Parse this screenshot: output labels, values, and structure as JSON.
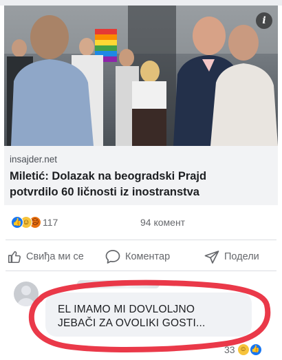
{
  "post": {
    "photo_badge": "i",
    "link_card": {
      "domain": "insajder.net",
      "headline": "Miletić: Dolazak na beogradski Prajd potvrdilo 60 ličnosti iz inostranstva"
    },
    "reactions": {
      "icons": [
        "like-icon",
        "haha-icon",
        "angry-icon"
      ],
      "count": "117",
      "comments": "94 комент"
    },
    "actions": {
      "like": "Свиђа ми се",
      "comment": "Коментар",
      "share": "Подели"
    }
  },
  "comment": {
    "text": "EL IMAMO MI DOVLOLJNO\nJEBAČI ZA OVOLIKI GOSTI...",
    "reaction_count": "33",
    "reaction_icons": [
      "haha-icon",
      "like-icon"
    ],
    "highlight_color": "#e8283a"
  },
  "colors": {
    "fb_blue": "#1877f2",
    "text_secondary": "#65676b",
    "card_bg": "#f2f3f5"
  }
}
